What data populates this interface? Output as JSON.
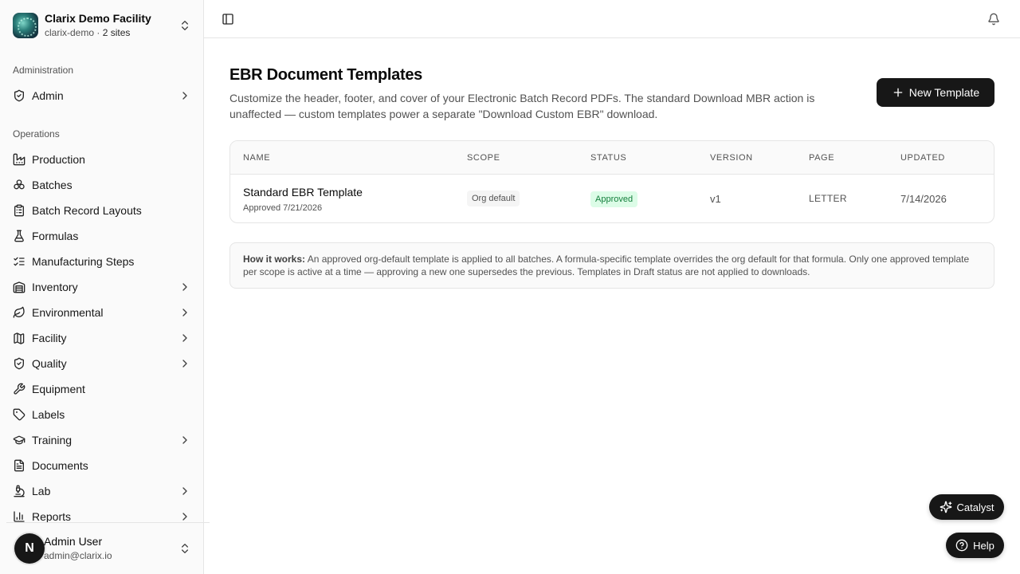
{
  "org": {
    "name": "Clarix Demo Facility",
    "slug": "clarix-demo",
    "sites": "2 sites"
  },
  "sidebar": {
    "groups": [
      {
        "label": "Administration",
        "items": [
          {
            "label": "Admin",
            "icon": "shield-check-icon",
            "has_children": true
          }
        ]
      },
      {
        "label": "Operations",
        "items": [
          {
            "label": "Production",
            "icon": "factory-icon",
            "has_children": false
          },
          {
            "label": "Batches",
            "icon": "boxes-icon",
            "has_children": false
          },
          {
            "label": "Batch Record Layouts",
            "icon": "clipboard-list-icon",
            "has_children": false
          },
          {
            "label": "Formulas",
            "icon": "flask-icon",
            "has_children": false
          },
          {
            "label": "Manufacturing Steps",
            "icon": "list-checks-icon",
            "has_children": false
          },
          {
            "label": "Inventory",
            "icon": "warehouse-icon",
            "has_children": true
          },
          {
            "label": "Environmental",
            "icon": "leaf-icon",
            "has_children": true
          },
          {
            "label": "Facility",
            "icon": "map-icon",
            "has_children": true
          },
          {
            "label": "Quality",
            "icon": "shield-check-icon",
            "has_children": true
          },
          {
            "label": "Equipment",
            "icon": "wrench-icon",
            "has_children": false
          },
          {
            "label": "Labels",
            "icon": "tag-icon",
            "has_children": false
          },
          {
            "label": "Training",
            "icon": "graduation-cap-icon",
            "has_children": true
          },
          {
            "label": "Documents",
            "icon": "file-text-icon",
            "has_children": false
          },
          {
            "label": "Lab",
            "icon": "microscope-icon",
            "has_children": true
          },
          {
            "label": "Reports",
            "icon": "bar-chart-icon",
            "has_children": true
          }
        ]
      }
    ]
  },
  "user": {
    "initial": "N",
    "name": "Admin User",
    "email": "admin@clarix.io"
  },
  "page": {
    "title": "EBR Document Templates",
    "description": "Customize the header, footer, and cover of your Electronic Batch Record PDFs. The standard Download MBR action is unaffected — custom templates power a separate \"Download Custom EBR\" download.",
    "new_button": "New Template"
  },
  "table": {
    "columns": [
      "Name",
      "Scope",
      "Status",
      "Version",
      "Page",
      "Updated"
    ],
    "rows": [
      {
        "name": "Standard EBR Template",
        "approved": "Approved 7/21/2026",
        "scope": "Org default",
        "status": "Approved",
        "version": "v1",
        "page": "LETTER",
        "updated": "7/14/2026"
      }
    ]
  },
  "info": {
    "heading": "How it works:",
    "text": "An approved org-default template is applied to all batches. A formula-specific template overrides the org default for that formula. Only one approved template per scope is active at a time — approving a new one supersedes the previous. Templates in Draft status are not applied to downloads."
  },
  "floating": {
    "catalyst": "Catalyst",
    "help": "Help"
  },
  "colors": {
    "primary": "#171717",
    "status_approved_bg": "#dcfce7",
    "status_approved_fg": "#15803d"
  }
}
